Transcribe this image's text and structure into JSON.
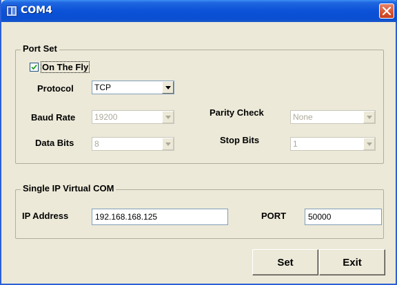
{
  "window": {
    "title": "COM4",
    "close_icon": "close-icon",
    "app_icon": "com-port-icon"
  },
  "port_set": {
    "legend": "Port Set",
    "on_the_fly": {
      "label": "On The Fly",
      "checked": true
    },
    "protocol": {
      "label": "Protocol",
      "value": "TCP",
      "enabled": true
    },
    "baud_rate": {
      "label": "Baud Rate",
      "value": "19200",
      "enabled": false
    },
    "parity_check": {
      "label": "Parity Check",
      "value": "None",
      "enabled": false
    },
    "data_bits": {
      "label": "Data Bits",
      "value": "8",
      "enabled": false
    },
    "stop_bits": {
      "label": "Stop Bits",
      "value": "1",
      "enabled": false
    }
  },
  "virtual_com": {
    "legend": "Single IP Virtual COM",
    "ip_address": {
      "label": "IP Address",
      "value": "192.168.168.125"
    },
    "port": {
      "label": "PORT",
      "value": "50000"
    }
  },
  "buttons": {
    "set_label": "Set",
    "exit_label": "Exit"
  },
  "colors": {
    "titlebar": "#0b52d8",
    "close_button": "#d9542f",
    "window_bg": "#ece9d8"
  }
}
